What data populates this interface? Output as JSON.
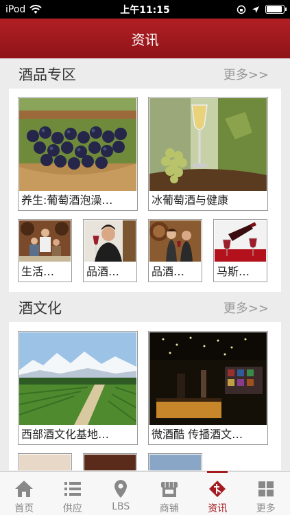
{
  "status_bar": {
    "carrier": "iPod",
    "time": "上午11:15"
  },
  "header": {
    "title": "资讯"
  },
  "sections": [
    {
      "title": "酒品专区",
      "more": "更多>>",
      "large_cards": [
        {
          "caption": "养生:葡萄酒泡澡…",
          "image": "red-grapes-basket"
        },
        {
          "caption": "冰葡萄酒与健康",
          "image": "white-wine-grapes"
        }
      ],
      "small_cards": [
        {
          "caption": "生活…",
          "image": "wine-tasting-group"
        },
        {
          "caption": "品酒…",
          "image": "man-tasting-wine"
        },
        {
          "caption": "品酒…",
          "image": "couple-wine-cellar"
        },
        {
          "caption": "马斯…",
          "image": "wine-bottle-glasses"
        }
      ]
    },
    {
      "title": "酒文化",
      "more": "更多>>",
      "large_cards": [
        {
          "caption": "西部酒文化基地…",
          "image": "vineyard-mountains"
        },
        {
          "caption": "微酒酷 传播酒文…",
          "image": "wine-bar-interior"
        }
      ]
    }
  ],
  "tabbar": {
    "items": [
      {
        "label": "首页",
        "icon": "home-icon",
        "active": false
      },
      {
        "label": "供应",
        "icon": "list-icon",
        "active": false
      },
      {
        "label": "LBS",
        "icon": "location-pin-icon",
        "active": false
      },
      {
        "label": "商铺",
        "icon": "store-icon",
        "active": false
      },
      {
        "label": "资讯",
        "icon": "news-icon",
        "active": true
      },
      {
        "label": "更多",
        "icon": "grid-icon",
        "active": false
      }
    ]
  },
  "colors": {
    "brand": "#a51a1f",
    "background": "#ececec"
  }
}
